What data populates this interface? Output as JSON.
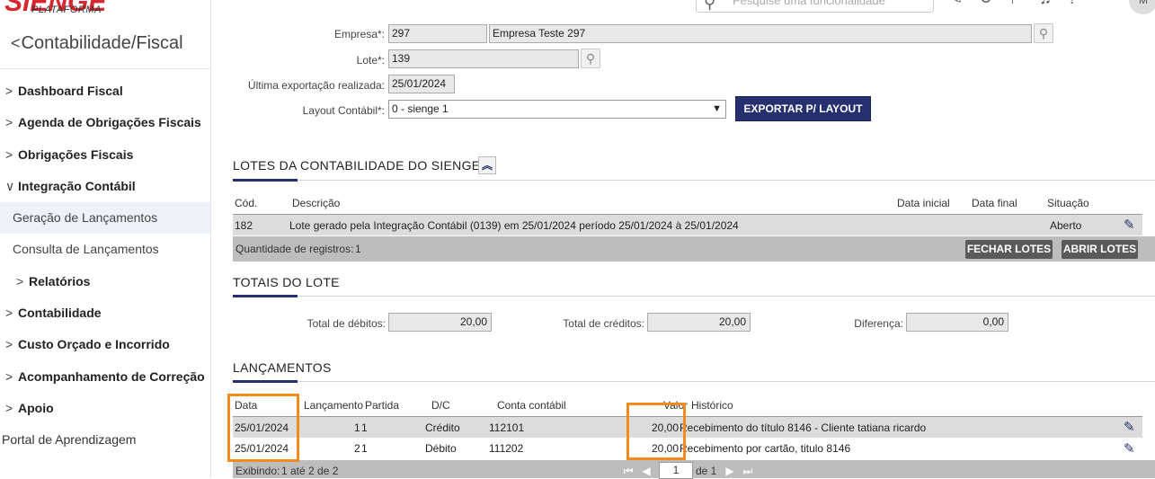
{
  "brand": {
    "logo": "SIENGE",
    "sub": "PLATAFORMA"
  },
  "header": {
    "search_placeholder": "Pesquise uma funcionalidade",
    "avatar": "M"
  },
  "sidebar": {
    "title": "Contabilidade/Fiscal",
    "items": [
      {
        "label": "Dashboard Fiscal"
      },
      {
        "label": "Agenda de Obrigações Fiscais"
      },
      {
        "label": "Obrigações Fiscais"
      },
      {
        "label": "Integração Contábil"
      },
      {
        "label": "Geração de Lançamentos"
      },
      {
        "label": "Consulta de Lançamentos"
      },
      {
        "label": "Relatórios"
      },
      {
        "label": "Contabilidade"
      },
      {
        "label": "Custo Orçado e Incorrido"
      },
      {
        "label": "Acompanhamento de Correção"
      },
      {
        "label": "Apoio"
      },
      {
        "label": "Portal de Aprendizagem"
      }
    ]
  },
  "form": {
    "empresa_label": "Empresa*:",
    "empresa_code": "297",
    "empresa_name": "Empresa Teste 297",
    "lote_label": "Lote*:",
    "lote_value": "139",
    "ultima_label": "Última exportação realizada:",
    "ultima_value": "25/01/2024",
    "layout_label": "Layout Contábil*:",
    "layout_value": "0 - sienge 1",
    "export_button": "EXPORTAR P/ LAYOUT"
  },
  "lotes": {
    "title": "LOTES DA CONTABILIDADE DO SIENGE",
    "headers": {
      "cod": "Cód.",
      "descricao": "Descrição",
      "data_inicial": "Data inicial",
      "data_final": "Data final",
      "situacao": "Situação"
    },
    "row": {
      "cod": "182",
      "descricao": "Lote gerado pela Integração Contábil (0139) em 25/01/2024 período 25/01/2024 à 25/01/2024",
      "situacao": "Aberto"
    },
    "count_label": "Quantidade de registros:",
    "count_value": "1",
    "close_button": "FECHAR LOTES",
    "open_button": "ABRIR LOTES"
  },
  "totais": {
    "title": "TOTAIS DO LOTE",
    "debitos_label": "Total de débitos:",
    "debitos_value": "20,00",
    "creditos_label": "Total de créditos:",
    "creditos_value": "20,00",
    "diferenca_label": "Diferença:",
    "diferenca_value": "0,00"
  },
  "lancamentos": {
    "title": "LANÇAMENTOS",
    "headers": {
      "data": "Data",
      "lancamento": "Lançamento",
      "partida": "Partida",
      "dc": "D/C",
      "conta": "Conta contábil",
      "valor": "Valor",
      "historico": "Histórico"
    },
    "rows": [
      {
        "data": "25/01/2024",
        "lancamento": "1",
        "partida": "1",
        "dc": "Crédito",
        "conta": "112101",
        "valor": "20,00",
        "historico": "Recebimento do título 8146 - Cliente tatiana ricardo"
      },
      {
        "data": "25/01/2024",
        "lancamento": "2",
        "partida": "1",
        "dc": "Débito",
        "conta": "111202",
        "valor": "20,00",
        "historico": "Recebimento por cartão, titulo 8146"
      }
    ],
    "footer_label": "Exibindo:",
    "footer_value": "1 até 2 de 2",
    "page": "1",
    "page_of": "de 1"
  },
  "colors": {
    "accent": "#27306e",
    "highlight": "#f28c1c",
    "brand": "#d7282f"
  }
}
